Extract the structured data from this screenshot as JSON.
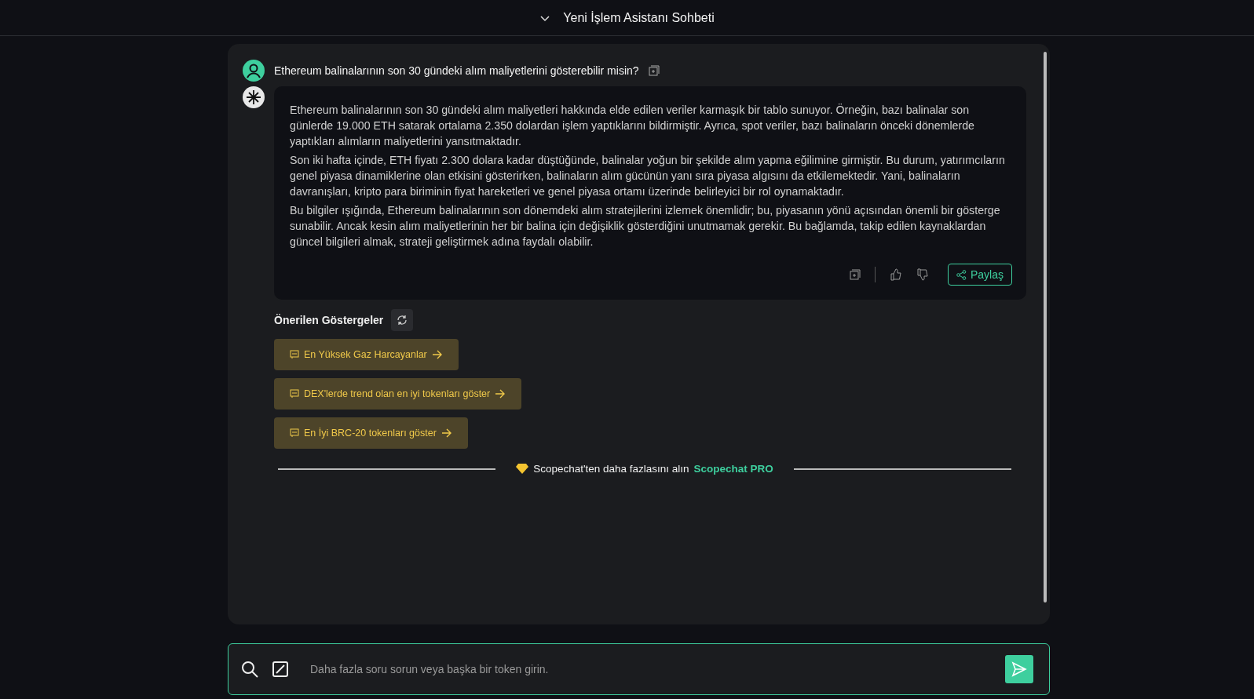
{
  "header": {
    "title": "Yeni İşlem Asistanı Sohbeti"
  },
  "question": "Ethereum balinalarının son 30 gündeki alım maliyetlerini gösterebilir misin?",
  "answer": [
    "Ethereum balinalarının son 30 gündeki alım maliyetleri hakkında elde edilen veriler karmaşık bir tablo sunuyor. Örneğin, bazı balinalar son günlerde 19.000 ETH satarak ortalama 2.350 dolardan işlem yaptıklarını bildirmiştir. Ayrıca, spot veriler, bazı balinaların önceki dönemlerde yaptıkları alımların maliyetlerini yansıtmaktadır.",
    "Son iki hafta içinde, ETH fiyatı 2.300 dolara kadar düştüğünde, balinalar yoğun bir şekilde alım yapma eğilimine girmiştir. Bu durum, yatırımcıların genel piyasa dinamiklerine olan etkisini gösterirken, balinaların alım gücünün yanı sıra piyasa algısını da etkilemektedir. Yani, balinaların davranışları, kripto para biriminin fiyat hareketleri ve genel piyasa ortamı üzerinde belirleyici bir rol oynamaktadır.",
    "Bu bilgiler ışığında, Ethereum balinalarının son dönemdeki alım stratejilerini izlemek önemlidir; bu, piyasanın yönü açısından önemli bir gösterge sunabilir. Ancak kesin alım maliyetlerinin her bir balina için değişiklik gösterdiğini unutmamak gerekir. Bu bağlamda, takip edilen kaynaklardan güncel bilgileri almak, strateji geliştirmek adına faydalı olabilir."
  ],
  "share_button": "Paylaş",
  "suggestions": {
    "title": "Önerilen Göstergeler",
    "items": [
      "En Yüksek Gaz Harcayanlar",
      "DEX'lerde trend olan en iyi tokenları göster",
      "En İyi BRC-20 tokenları göster"
    ]
  },
  "promo": {
    "text": "Scopechat'ten daha fazlasını alın",
    "link": "Scopechat PRO"
  },
  "input": {
    "placeholder": "Daha fazla soru sorun veya başka bir token girin."
  }
}
